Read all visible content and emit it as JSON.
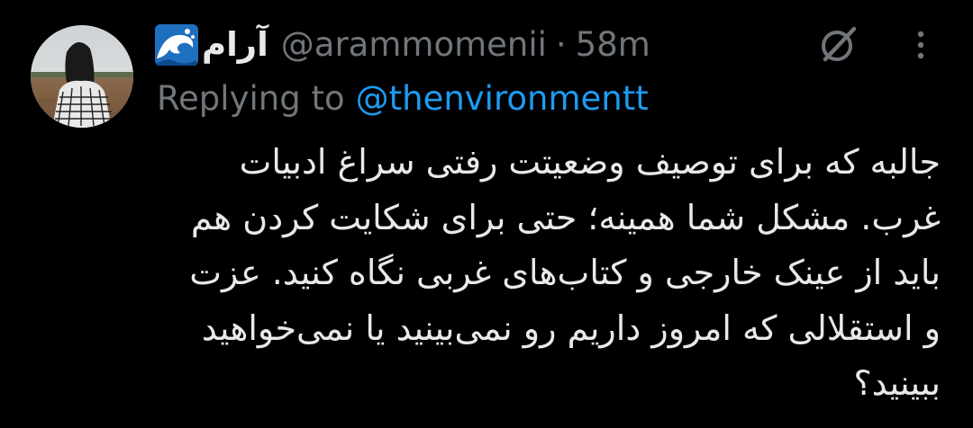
{
  "tweet": {
    "author": {
      "display_name": "آرام",
      "name_emoji": "wave-emoji-icon",
      "handle": "@arammomenii",
      "separator": "·",
      "time": "58m"
    },
    "reply": {
      "prefix": "Replying to",
      "handle": "@thenvironmentt"
    },
    "text_lines": [
      "جالبه که برای توصیف وضعیتت رفتی سراغ ادبیات",
      "غرب. مشکل شما همینه؛ حتی برای شکایت کردن هم",
      "باید از عینک خارجی و کتاب‌های غربی نگاه کنید. عزت",
      "و استقلالی که امروز داریم رو نمی‌بینید یا نمی‌خواهید",
      "ببینید؟"
    ],
    "icons": {
      "grok": "grok-slash-icon",
      "more": "more-vertical-icon"
    },
    "colors": {
      "background": "#000000",
      "text": "#e7e9ea",
      "muted": "#71767b",
      "link": "#1d9bf0"
    }
  }
}
